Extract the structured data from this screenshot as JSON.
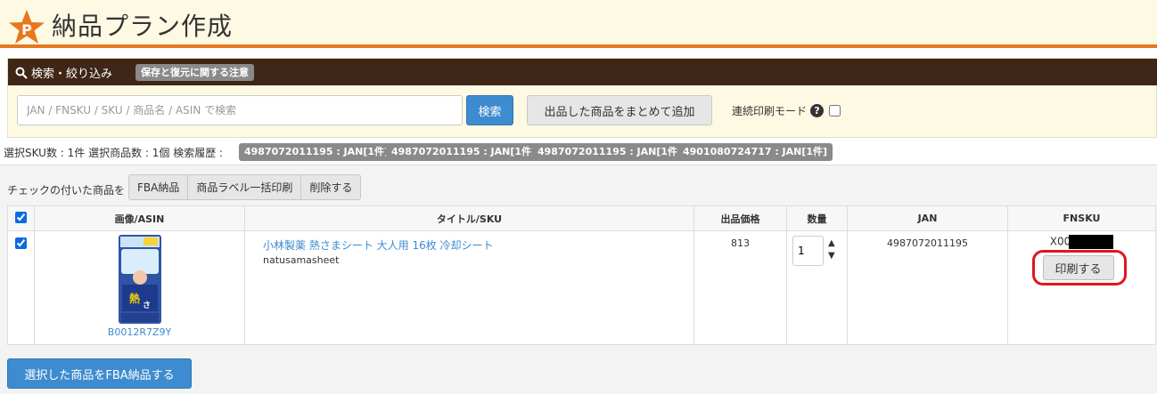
{
  "header": {
    "logo_letter": "P",
    "title": "納品プラン作成"
  },
  "search": {
    "bar_title": "検索・絞り込み",
    "notice_badge": "保存と復元に関する注意",
    "placeholder": "JAN / FNSKU / SKU / 商品名 / ASIN で検索",
    "value": "",
    "search_button": "検索",
    "bulk_add_button": "出品した商品をまとめて追加",
    "continuous_print_label": "連続印刷モード",
    "continuous_print_checked": false
  },
  "stats": {
    "summary": "選択SKU数 : 1件 選択商品数 : 1個  検索履歴 :",
    "history": [
      "4987072011195 : JAN[1件]",
      "4987072011195 : JAN[1件]",
      "4987072011195 : JAN[1件]",
      "4901080724717 : JAN[1件]"
    ]
  },
  "bulk_actions": {
    "label": "チェックの付いた商品を",
    "buttons": [
      "FBA納品",
      "商品ラベル一括印刷",
      "削除する"
    ]
  },
  "table": {
    "headers": [
      "",
      "画像/ASIN",
      "タイトル/SKU",
      "出品価格",
      "数量",
      "JAN",
      "FNSKU"
    ],
    "header_checked": true,
    "rows": [
      {
        "checked": true,
        "asin": "B0012R7Z9Y",
        "title": "小林製薬 熱さまシート 大人用 16枚 冷却シート",
        "sku": "natusamasheet",
        "price": "813",
        "quantity": "1",
        "jan": "4987072011195",
        "fnsku_prefix": "X00",
        "print_button": "印刷する"
      }
    ]
  },
  "submit_button": "選択した商品をFBA納品する",
  "colors": {
    "header_bg": "#fdf9e3",
    "accent_orange": "#e8771e",
    "search_bar_bg": "#3f2616",
    "primary_blue": "#3e8bcf",
    "highlight_red": "#e0161e"
  }
}
